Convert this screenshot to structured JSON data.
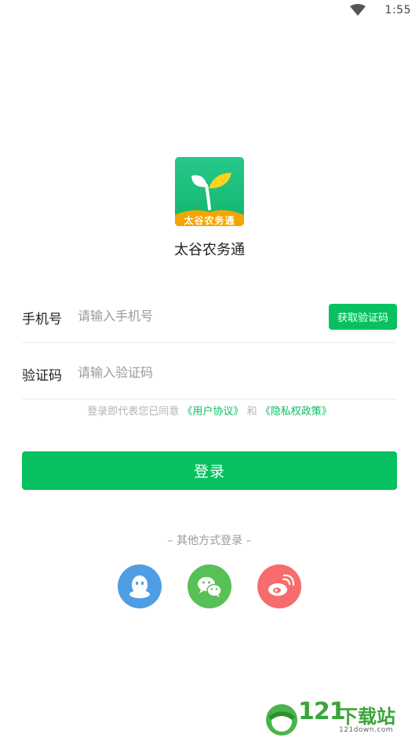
{
  "status_bar": {
    "time": "1:55",
    "wifi_icon": "wifi-icon"
  },
  "app": {
    "name": "太谷农务通",
    "logo_banner": "太谷农务通",
    "logo_icon": "sprout-icon"
  },
  "form": {
    "phone": {
      "label": "手机号",
      "placeholder": "请输入手机号",
      "value": ""
    },
    "code": {
      "label": "验证码",
      "placeholder": "请输入验证码",
      "value": "",
      "get_code_label": "获取验证码"
    }
  },
  "agreement": {
    "prefix": "登录即代表您已同意",
    "user_agreement": "《用户协议》",
    "conjunction": "和",
    "privacy_policy": "《隐私权政策》"
  },
  "login_button": "登录",
  "other_login": {
    "label": "– 其他方式登录 –",
    "providers": [
      "qq-icon",
      "wechat-icon",
      "weibo-icon"
    ]
  },
  "watermark": {
    "number": "121",
    "text": "下载站",
    "sub": "121down.com"
  },
  "colors": {
    "accent": "#07c160",
    "qq": "#4f9de3",
    "wechat": "#58c155",
    "weibo": "#f76c6c"
  }
}
